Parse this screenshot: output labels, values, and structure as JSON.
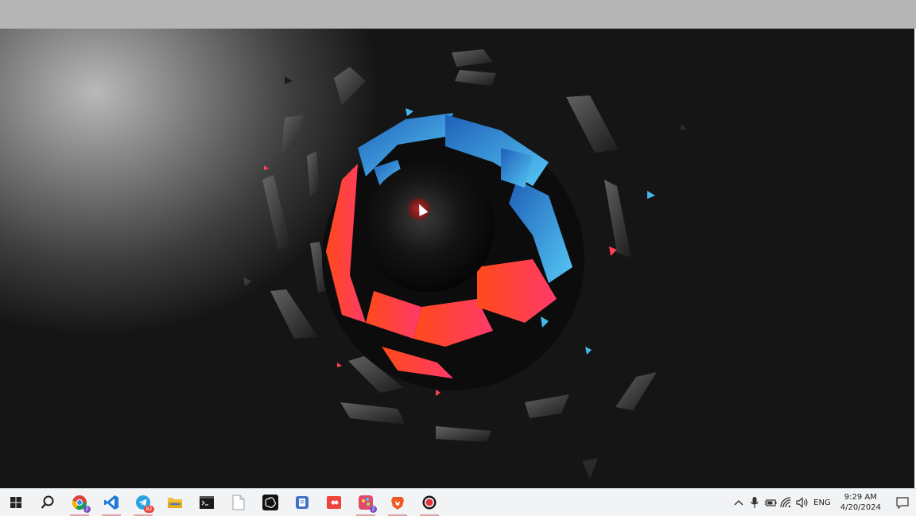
{
  "window": {
    "title": ""
  },
  "desktop": {
    "wallpaper": "abstract-shattered-sphere"
  },
  "taskbar": {
    "pinned": [
      {
        "name": "start-button",
        "icon": "windows-logo-icon",
        "running": false
      },
      {
        "name": "search-button",
        "icon": "search-icon",
        "running": false
      },
      {
        "name": "chrome-button",
        "icon": "chrome-icon",
        "running": true,
        "badge": "2"
      },
      {
        "name": "vscode-button",
        "icon": "vscode-icon",
        "running": true
      },
      {
        "name": "telegram-button",
        "icon": "telegram-icon",
        "running": true,
        "badge": "82"
      },
      {
        "name": "file-explorer-button",
        "icon": "folder-icon",
        "running": false
      },
      {
        "name": "terminal-button",
        "icon": "terminal-icon",
        "running": false
      },
      {
        "name": "notepad-button",
        "icon": "document-icon",
        "running": false
      },
      {
        "name": "chatgpt-button",
        "icon": "chatgpt-icon",
        "running": false
      },
      {
        "name": "clipboard-button",
        "icon": "clipboard-icon",
        "running": false
      },
      {
        "name": "anydesk-button",
        "icon": "anydesk-icon",
        "running": false
      },
      {
        "name": "paint-button",
        "icon": "paint-icon",
        "running": true,
        "badge": "2"
      },
      {
        "name": "brave-button",
        "icon": "brave-icon",
        "running": true
      },
      {
        "name": "recorder-button",
        "icon": "record-icon",
        "running": true
      }
    ],
    "tray": {
      "language": "ENG",
      "time": "9:29 AM",
      "date": "4/20/2024"
    }
  },
  "colors": {
    "taskbar_bg": "#f1f3f5",
    "top_bar": "#b5b5b5",
    "accent_blue": "#2f9fe6",
    "accent_red": "#e2343c"
  }
}
